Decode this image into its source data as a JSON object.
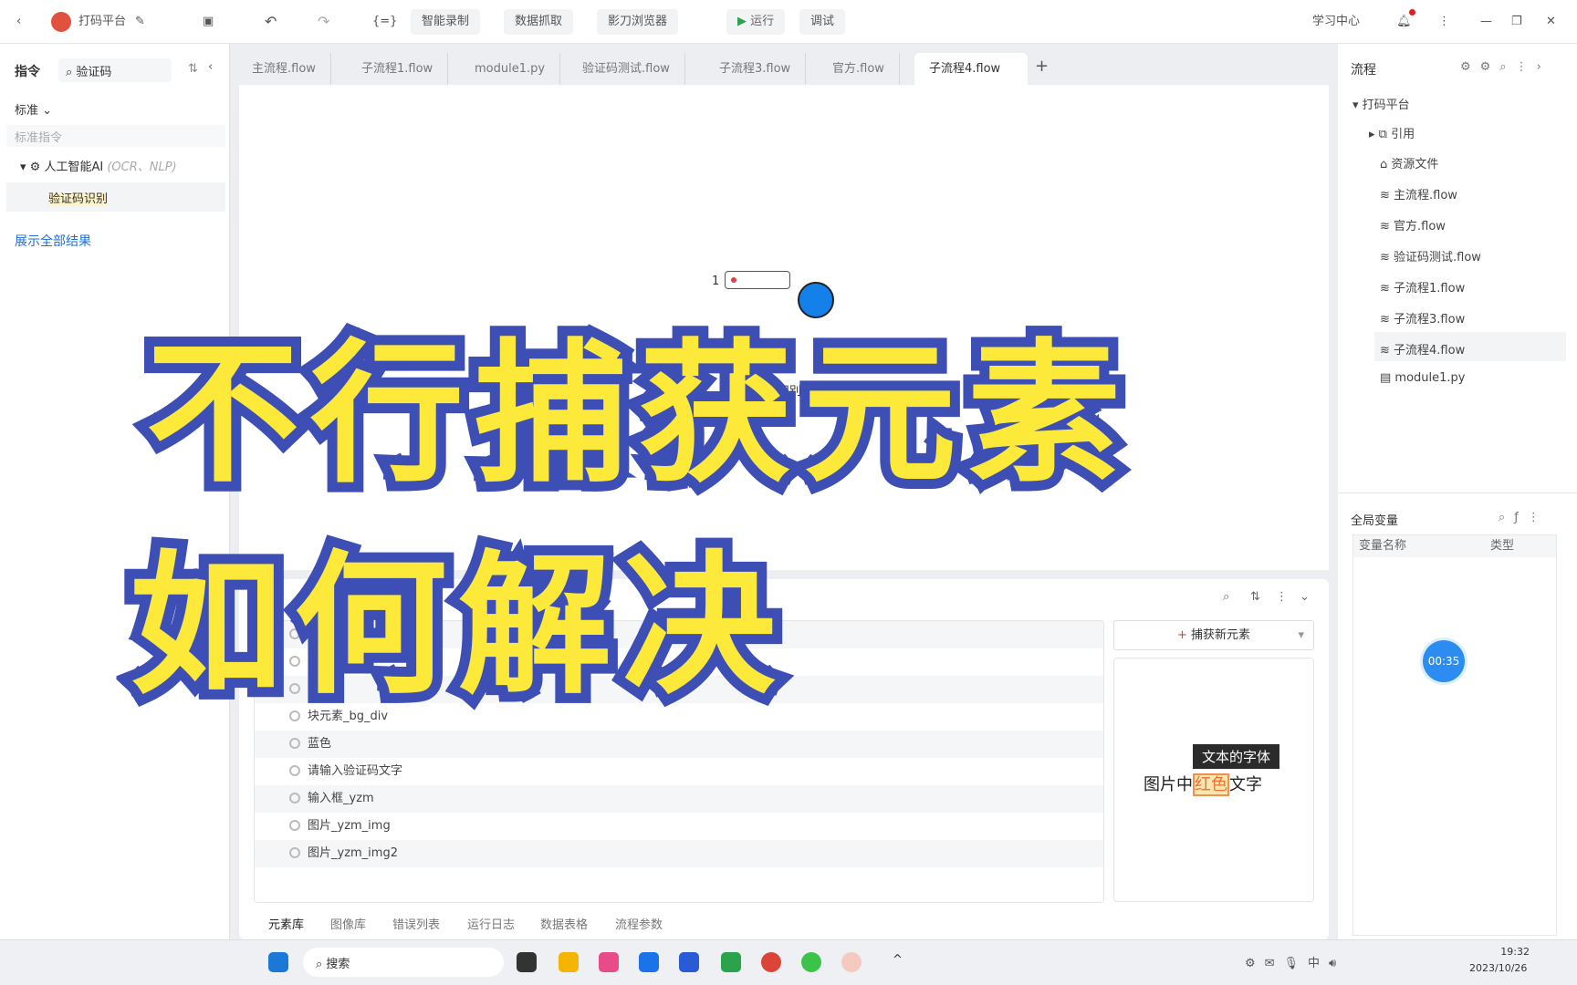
{
  "topbar": {
    "app_title": "打码平台",
    "undo": "↶",
    "redo": "↷",
    "smart_record": "智能录制",
    "data_capture": "数据抓取",
    "browser": "影刀浏览器",
    "run": "运行",
    "debug": "调试",
    "learning_center": "学习中心"
  },
  "left": {
    "title": "指令",
    "search_value": "验证码",
    "category": "标准",
    "placeholder": "标准指令",
    "group": "人工智能AI",
    "group_hint": "(OCR、NLP)",
    "item": "验证码识别",
    "show_all": "展示全部结果"
  },
  "tabs": [
    "主流程.flow",
    "子流程1.flow",
    "module1.py",
    "验证码测试.flow",
    "子流程3.flow",
    "官方.flow",
    "子流程4.flow"
  ],
  "canvas": {
    "step_number": "1",
    "node_label": "识别小"
  },
  "elements": {
    "rows": [
      "",
      "",
      "黄色",
      "块元素_bg_div",
      "蓝色",
      "请输入验证码文字",
      "输入框_yzm",
      "图片_yzm_img",
      "图片_yzm_img2"
    ],
    "capture_button": "捕获新元素",
    "preview_text_a": "图片中",
    "preview_text_b": "红色",
    "preview_text_c": "文字",
    "tooltip": "文本的字体"
  },
  "bottom_tabs": [
    "元素库",
    "图像库",
    "错误列表",
    "运行日志",
    "数据表格",
    "流程参数"
  ],
  "right": {
    "title": "流程",
    "root": "打码平台",
    "items": [
      "引用",
      "资源文件",
      "主流程.flow",
      "官方.flow",
      "验证码测试.flow",
      "子流程1.flow",
      "子流程3.flow",
      "子流程4.flow",
      "module1.py"
    ],
    "vars_title": "全局变量",
    "col_name": "变量名称",
    "col_type": "类型",
    "timer": "00:35"
  },
  "taskbar": {
    "search": "搜索",
    "time": "19:32",
    "date": "2023/10/26"
  },
  "overlay": {
    "line1": "不行捕获元素",
    "line2": "如何解决"
  },
  "colors": {
    "accent": "#1e6fd9",
    "overlay_fill": "#fde93a",
    "overlay_stroke": "#3d4fb5"
  }
}
